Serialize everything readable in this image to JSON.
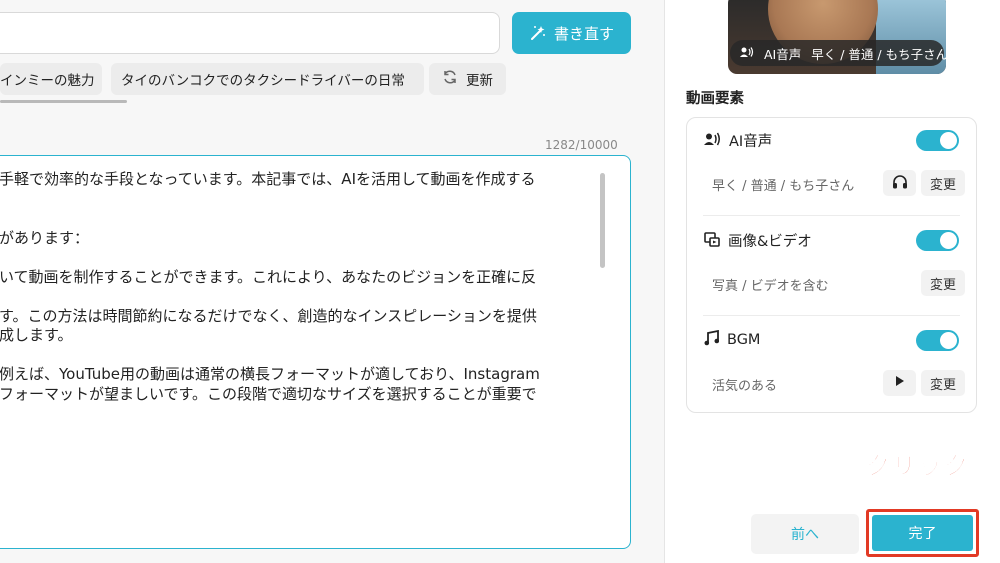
{
  "prompt": {
    "value": ""
  },
  "toolbar": {
    "rewrite_label": "書き直す"
  },
  "suggestions": [
    {
      "label": "インミーの魅力"
    },
    {
      "label": "タイのバンコクでのタクシードライバーの日常"
    },
    {
      "label": "更新",
      "icon": "refresh-icon"
    }
  ],
  "editor": {
    "char_count": "1282/10000",
    "lines": [
      "手軽で効率的な手段となっています。本記事では、AIを活用して動画を作成する",
      "",
      "",
      "があります：",
      "",
      "いて動画を制作することができます。これにより、あなたのビジョンを正確に反",
      "",
      "す。この方法は時間節約になるだけでなく、創造的なインスピレーションを提供",
      "成します。",
      "",
      "例えば、YouTube用の動画は通常の横長フォーマットが適しており、Instagram",
      "フォーマットが望ましいです。この段階で適切なサイズを選択することが重要で"
    ]
  },
  "preview": {
    "caption_label": "AI音声",
    "caption_value": "早く / 普通 / もち子さん",
    "caption_icon": "voice-icon"
  },
  "elements": {
    "title": "動画要素",
    "items": [
      {
        "title": "AI音声",
        "icon": "voice-icon",
        "enabled": true,
        "sub": "早く / 普通 / もち子さん",
        "action_icon": "headphones-icon",
        "change_label": "変更"
      },
      {
        "title": "画像&ビデオ",
        "icon": "image-video-icon",
        "enabled": true,
        "sub": "写真 / ビデオを含む",
        "change_label": "変更"
      },
      {
        "title": "BGM",
        "icon": "music-note-icon",
        "enabled": true,
        "sub": "活気のある",
        "action_icon": "play-icon",
        "change_label": "変更"
      }
    ]
  },
  "annotation": {
    "click_label": "クリック",
    "color": "#e23a25"
  },
  "footer": {
    "prev_label": "前へ",
    "done_label": "完了"
  },
  "colors": {
    "accent": "#2bb3cf",
    "highlight": "#e23a25"
  }
}
